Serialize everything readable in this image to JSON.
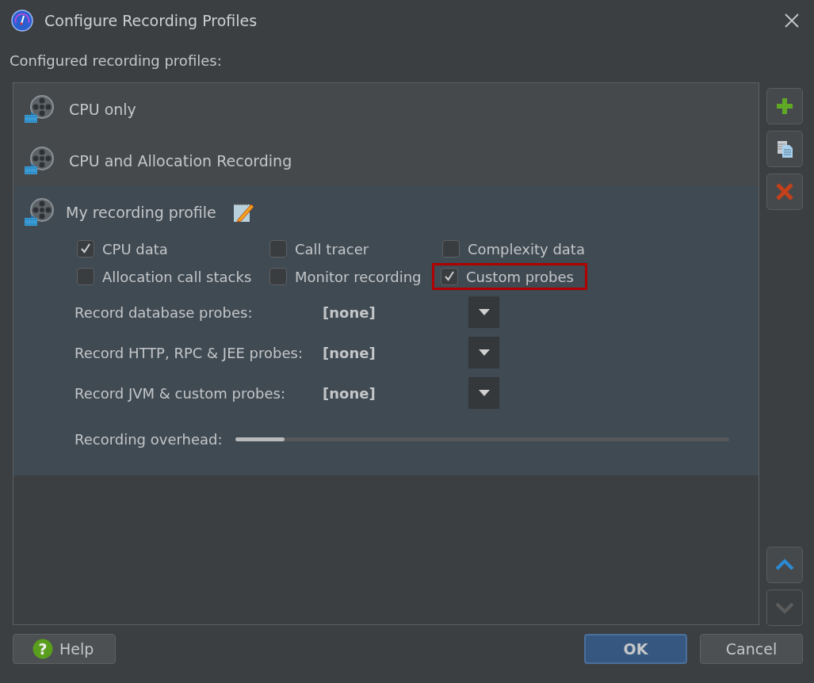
{
  "window": {
    "title": "Configure Recording Profiles"
  },
  "list_label": "Configured recording profiles:",
  "profiles": [
    {
      "name": "CPU only",
      "selected": false,
      "editable": false
    },
    {
      "name": "CPU and Allocation Recording",
      "selected": false,
      "editable": false
    },
    {
      "name": "My recording profile",
      "selected": true,
      "editable": true
    }
  ],
  "options": {
    "checkboxes": [
      {
        "label": "CPU data",
        "checked": true,
        "highlighted": false
      },
      {
        "label": "Call tracer",
        "checked": false,
        "highlighted": false
      },
      {
        "label": "Complexity data",
        "checked": false,
        "highlighted": false
      },
      {
        "label": "Allocation call stacks",
        "checked": false,
        "highlighted": false
      },
      {
        "label": "Monitor recording",
        "checked": false,
        "highlighted": false
      },
      {
        "label": "Custom probes",
        "checked": true,
        "highlighted": true
      }
    ],
    "dropdowns": [
      {
        "label": "Record database probes:",
        "value": "[none]"
      },
      {
        "label": "Record HTTP, RPC & JEE probes:",
        "value": "[none]"
      },
      {
        "label": "Record JVM & custom probes:",
        "value": "[none]"
      }
    ],
    "overhead": {
      "label": "Recording overhead:",
      "level": 0.1
    }
  },
  "side_buttons": [
    {
      "kind": "add",
      "disabled": false
    },
    {
      "kind": "copy",
      "disabled": false
    },
    {
      "kind": "delete",
      "disabled": false
    }
  ],
  "move_buttons": [
    {
      "kind": "up",
      "disabled": false
    },
    {
      "kind": "down",
      "disabled": true
    }
  ],
  "buttons": [
    {
      "kind": "help",
      "label": "Help",
      "icon": "?"
    },
    {
      "kind": "ok",
      "label": "OK"
    },
    {
      "kind": "cancel",
      "label": "Cancel"
    }
  ]
}
